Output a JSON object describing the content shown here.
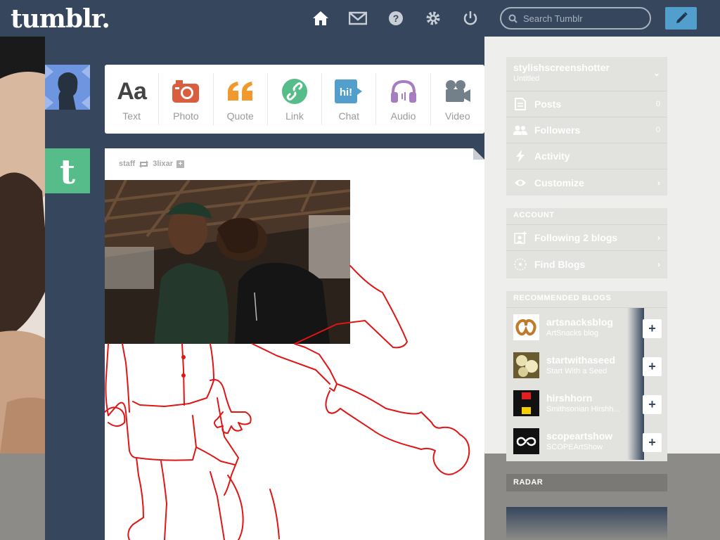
{
  "topbar": {
    "logo": "tumblr.",
    "search_placeholder": "Search Tumblr",
    "nav_icons": [
      "home-icon",
      "mail-icon",
      "help-icon",
      "gear-icon",
      "power-icon"
    ],
    "compose_icon": "pencil-icon"
  },
  "post_types": [
    {
      "label": "Text",
      "glyph": "Aa",
      "color": "#444444"
    },
    {
      "label": "Photo",
      "color": "#d95e40"
    },
    {
      "label": "Quote",
      "glyph": "“",
      "color": "#f2992e"
    },
    {
      "label": "Link",
      "color": "#56bc8a"
    },
    {
      "label": "Chat",
      "glyph": "hi!",
      "color": "#529ecc"
    },
    {
      "label": "Audio",
      "color": "#a77dc2"
    },
    {
      "label": "Video",
      "color": "#748089"
    }
  ],
  "post": {
    "author": "staff",
    "reblogged_from": "3lixar"
  },
  "sidebar": {
    "blog": {
      "name": "stylishscreenshotter",
      "subtitle": "Untitled",
      "rows": [
        {
          "label": "Posts",
          "count": "0",
          "icon": "posts-icon"
        },
        {
          "label": "Followers",
          "count": "0",
          "icon": "followers-icon"
        },
        {
          "label": "Activity",
          "count": "",
          "icon": "activity-icon"
        },
        {
          "label": "Customize",
          "count": "",
          "icon": "eye-icon"
        }
      ]
    },
    "account": {
      "heading": "ACCOUNT",
      "rows": [
        {
          "label": "Following 2 blogs",
          "icon": "following-icon"
        },
        {
          "label": "Find Blogs",
          "icon": "compass-icon"
        }
      ]
    },
    "recommended": {
      "heading": "RECOMMENDED BLOGS",
      "blogs": [
        {
          "name": "artsnacksblog",
          "desc": "ArtSnacks blog"
        },
        {
          "name": "startwithaseed",
          "desc": "Start With a Seed"
        },
        {
          "name": "hirshhorn",
          "desc": "Smithsonian Hirshh..."
        },
        {
          "name": "scopeartshow",
          "desc": "SCOPEArtShow"
        }
      ]
    },
    "radar_heading": "RADAR"
  }
}
